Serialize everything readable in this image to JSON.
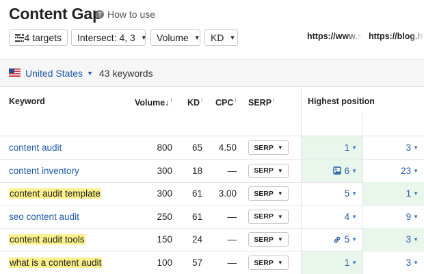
{
  "header": {
    "title": "Content Gap",
    "how_to_use": "How to use"
  },
  "filters": {
    "targets": "4 targets",
    "intersect": "Intersect: 4, 3",
    "volume": "Volume",
    "kd": "KD"
  },
  "location": {
    "country": "United States",
    "keywords_count": "43 keywords"
  },
  "columns": {
    "keyword": "Keyword",
    "volume": "Volume",
    "volume_sort": "↓",
    "kd": "KD",
    "cpc": "CPC",
    "serp": "SERP",
    "info": "i",
    "highest_position": "Highest position",
    "urls": [
      "https://www.s",
      "https://blog.hu"
    ]
  },
  "rows": [
    {
      "keyword": "content audit",
      "volume": "800",
      "kd": "65",
      "cpc": "4.50",
      "serp": "SERP",
      "pos1": "1",
      "pos2": "3",
      "highlighted": false,
      "best": 1,
      "feature": ""
    },
    {
      "keyword": "content inventory",
      "volume": "300",
      "kd": "18",
      "cpc": "—",
      "serp": "SERP",
      "pos1": "6",
      "pos2": "23",
      "highlighted": false,
      "best": 1,
      "feature": "image-icon"
    },
    {
      "keyword": "content audit template",
      "volume": "300",
      "kd": "61",
      "cpc": "3.00",
      "serp": "SERP",
      "pos1": "5",
      "pos2": "1",
      "highlighted": true,
      "best": 2,
      "feature": ""
    },
    {
      "keyword": "seo content audit",
      "volume": "250",
      "kd": "61",
      "cpc": "—",
      "serp": "SERP",
      "pos1": "4",
      "pos2": "9",
      "highlighted": false,
      "best": 0,
      "feature": ""
    },
    {
      "keyword": "content audit tools",
      "volume": "150",
      "kd": "24",
      "cpc": "—",
      "serp": "SERP",
      "pos1": "5",
      "pos2": "3",
      "highlighted": true,
      "best": 2,
      "feature": "link-icon"
    },
    {
      "keyword": "what is a content audit",
      "volume": "100",
      "kd": "57",
      "cpc": "—",
      "serp": "SERP",
      "pos1": "1",
      "pos2": "3",
      "highlighted": true,
      "best": 1,
      "feature": ""
    }
  ],
  "colors": {
    "link": "#1f5aa6",
    "highlight": "#fbf08a",
    "best_position_bg": "#e9f6ec"
  }
}
